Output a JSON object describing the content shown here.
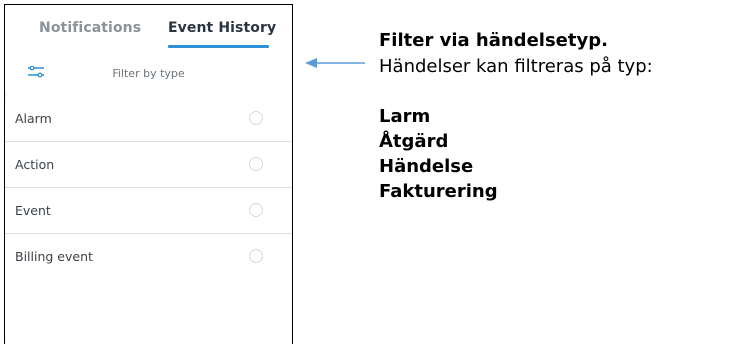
{
  "tabs": [
    {
      "label": "Notifications",
      "active": false
    },
    {
      "label": "Event History",
      "active": true
    }
  ],
  "filter": {
    "icon": "filter-sliders-icon",
    "label": "Filter by type"
  },
  "list": {
    "items": [
      {
        "label": "Alarm",
        "selected": false
      },
      {
        "label": "Action",
        "selected": false
      },
      {
        "label": "Event",
        "selected": false
      },
      {
        "label": "Billing event",
        "selected": false
      }
    ]
  },
  "annotation": {
    "arrow_icon": "left-arrow-icon",
    "title": "Filter via händelsetyp.",
    "text": "Händelser kan filtreras på typ:",
    "items": [
      "Larm",
      "Åtgärd",
      "Händelse",
      "Fakturering"
    ]
  },
  "colors": {
    "accent": "#2d8fd6",
    "arrow": "#5b9bd5"
  }
}
